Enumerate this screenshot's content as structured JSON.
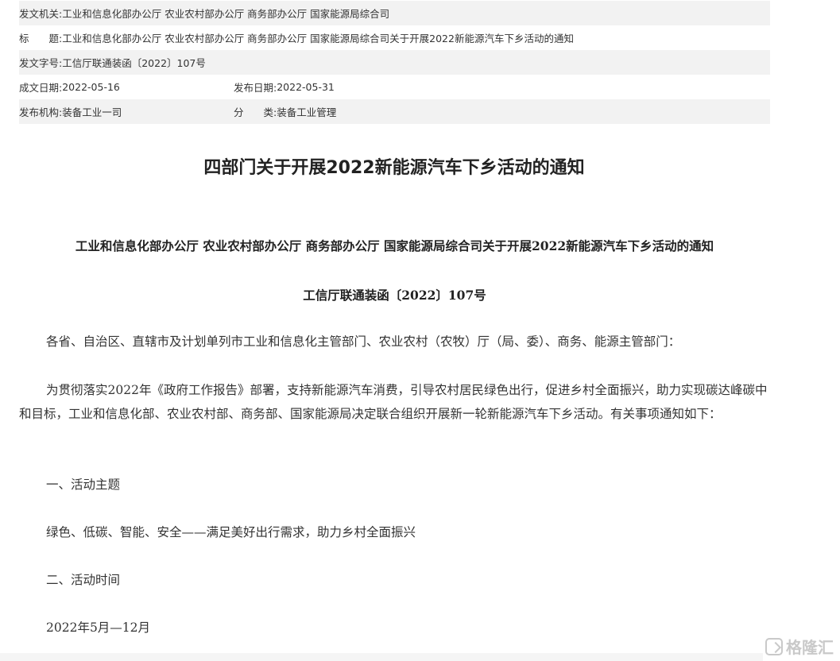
{
  "meta": {
    "issuer": {
      "label": "发文机关:",
      "value": "工业和信息化部办公厅 农业农村部办公厅 商务部办公厅 国家能源局综合司"
    },
    "title": {
      "label": "标　　题:",
      "value": "工业和信息化部办公厅 农业农村部办公厅 商务部办公厅 国家能源局综合司关于开展2022新能源汽车下乡活动的通知"
    },
    "doc_number": {
      "label": "发文字号:",
      "value": "工信厅联通装函〔2022〕107号"
    },
    "created": {
      "label": "成文日期:",
      "value": "2022-05-16"
    },
    "published": {
      "label": "发布日期:",
      "value": "2022-05-31"
    },
    "agency": {
      "label": "发布机构:",
      "value": "装备工业一司"
    },
    "category": {
      "label": "分　　类:",
      "value": "装备工业管理"
    }
  },
  "article": {
    "title": "四部门关于开展2022新能源汽车下乡活动的通知",
    "full_title": "工业和信息化部办公厅  农业农村部办公厅  商务部办公厅  国家能源局综合司关于开展2022新能源汽车下乡活动的通知",
    "doc_number": "工信厅联通装函〔2022〕107号",
    "salutation": "各省、自治区、直辖市及计划单列市工业和信息化主管部门、农业农村（农牧）厅（局、委）、商务、能源主管部门：",
    "intro": "为贯彻落实2022年《政府工作报告》部署，支持新能源汽车消费，引导农村居民绿色出行，促进乡村全面振兴，助力实现碳达峰碳中和目标，工业和信息化部、农业农村部、商务部、国家能源局决定联合组织开展新一轮新能源汽车下乡活动。有关事项通知如下：",
    "section1_heading": "一、活动主题",
    "section1_text": "绿色、低碳、智能、安全——满足美好出行需求，助力乡村全面振兴",
    "section2_heading": "二、活动时间",
    "section2_text": "2022年5月—12月"
  },
  "watermark": {
    "text": "格隆汇",
    "icon": "gelonghui-logo-icon"
  }
}
